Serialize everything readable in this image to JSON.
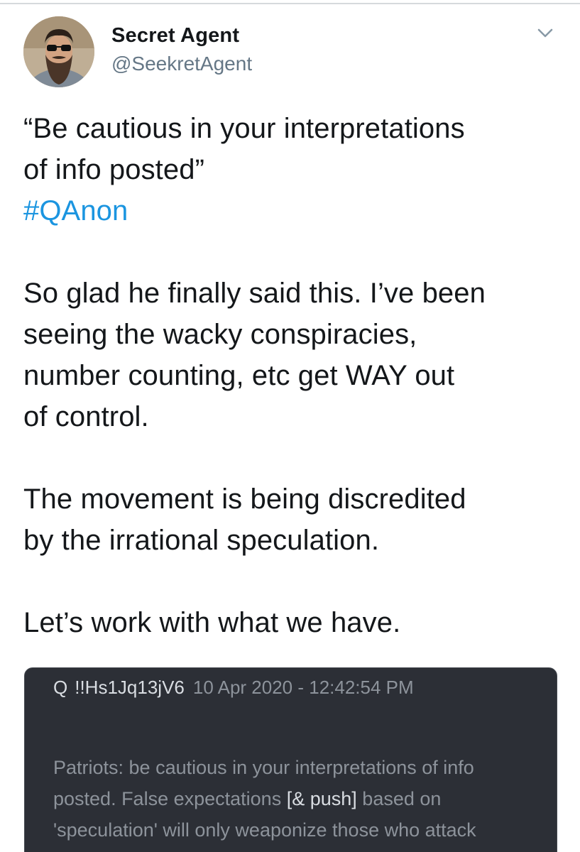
{
  "tweet": {
    "author": {
      "display_name": "Secret Agent",
      "handle": "@SeekretAgent"
    },
    "more_icon": "chevron-down-icon",
    "text": {
      "quote_line_1": "“Be cautious in your interpretations",
      "quote_line_2": "of info posted”",
      "hashtag": "#QAnon",
      "p2_line_1": "So glad he finally said this. I’ve been",
      "p2_line_2": "seeing the wacky conspiracies,",
      "p2_line_3": "number counting, etc get WAY out",
      "p2_line_4": "of control.",
      "p3_line_1": "The movement is being discredited",
      "p3_line_2": "by the irrational speculation.",
      "p4_line_1": "Let’s work with what we have."
    },
    "hashtag_color": "#1b95e0"
  },
  "screenshot": {
    "header": {
      "name": "Q",
      "tripcode": "!!Hs1Jq13jV6",
      "timestamp": "10 Apr 2020 - 12:42:54 PM"
    },
    "body": {
      "line_1": "Patriots: be cautious in your interpretations of info",
      "line_2_prefix": "posted. False expectations",
      "line_2_bracket": "[& push]",
      "line_2_suffix": "based on",
      "line_3": "'speculation' will only weaponize those who attack"
    },
    "background_color": "#2c2f36"
  }
}
